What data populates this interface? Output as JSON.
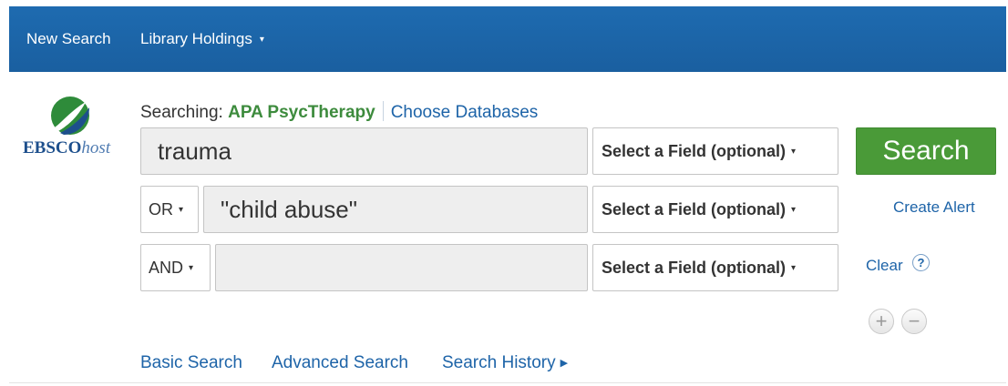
{
  "topbar": {
    "new_search": "New Search",
    "library_holdings": "Library Holdings",
    "caret": "▾",
    "color": "#1e6bb0"
  },
  "logo": {
    "brand_bold": "EBSCO",
    "brand_italic": "host"
  },
  "searching": {
    "label": "Searching:",
    "database": "APA PsycTherapy",
    "choose_databases": "Choose Databases"
  },
  "rows": [
    {
      "operator": "",
      "query": "trauma",
      "field": "Select a Field (optional)"
    },
    {
      "operator": "OR",
      "query": "\"child abuse\"",
      "field": "Select a Field (optional)"
    },
    {
      "operator": "AND",
      "query": "",
      "field": "Select a Field (optional)"
    }
  ],
  "actions": {
    "search": "Search",
    "create_alert": "Create Alert",
    "clear": "Clear",
    "help": "?",
    "add_row": "+",
    "remove_row": "−"
  },
  "bottom_links": {
    "basic_search": "Basic Search",
    "advanced_search": "Advanced Search",
    "search_history": "Search History"
  },
  "icons": {
    "dropdown": "chevron-down-icon",
    "history": "caret-right-icon",
    "help": "question-mark-icon"
  },
  "colors": {
    "link": "#1e64a8",
    "search_button": "#4a9a38",
    "database_name": "#3d8b3d"
  }
}
